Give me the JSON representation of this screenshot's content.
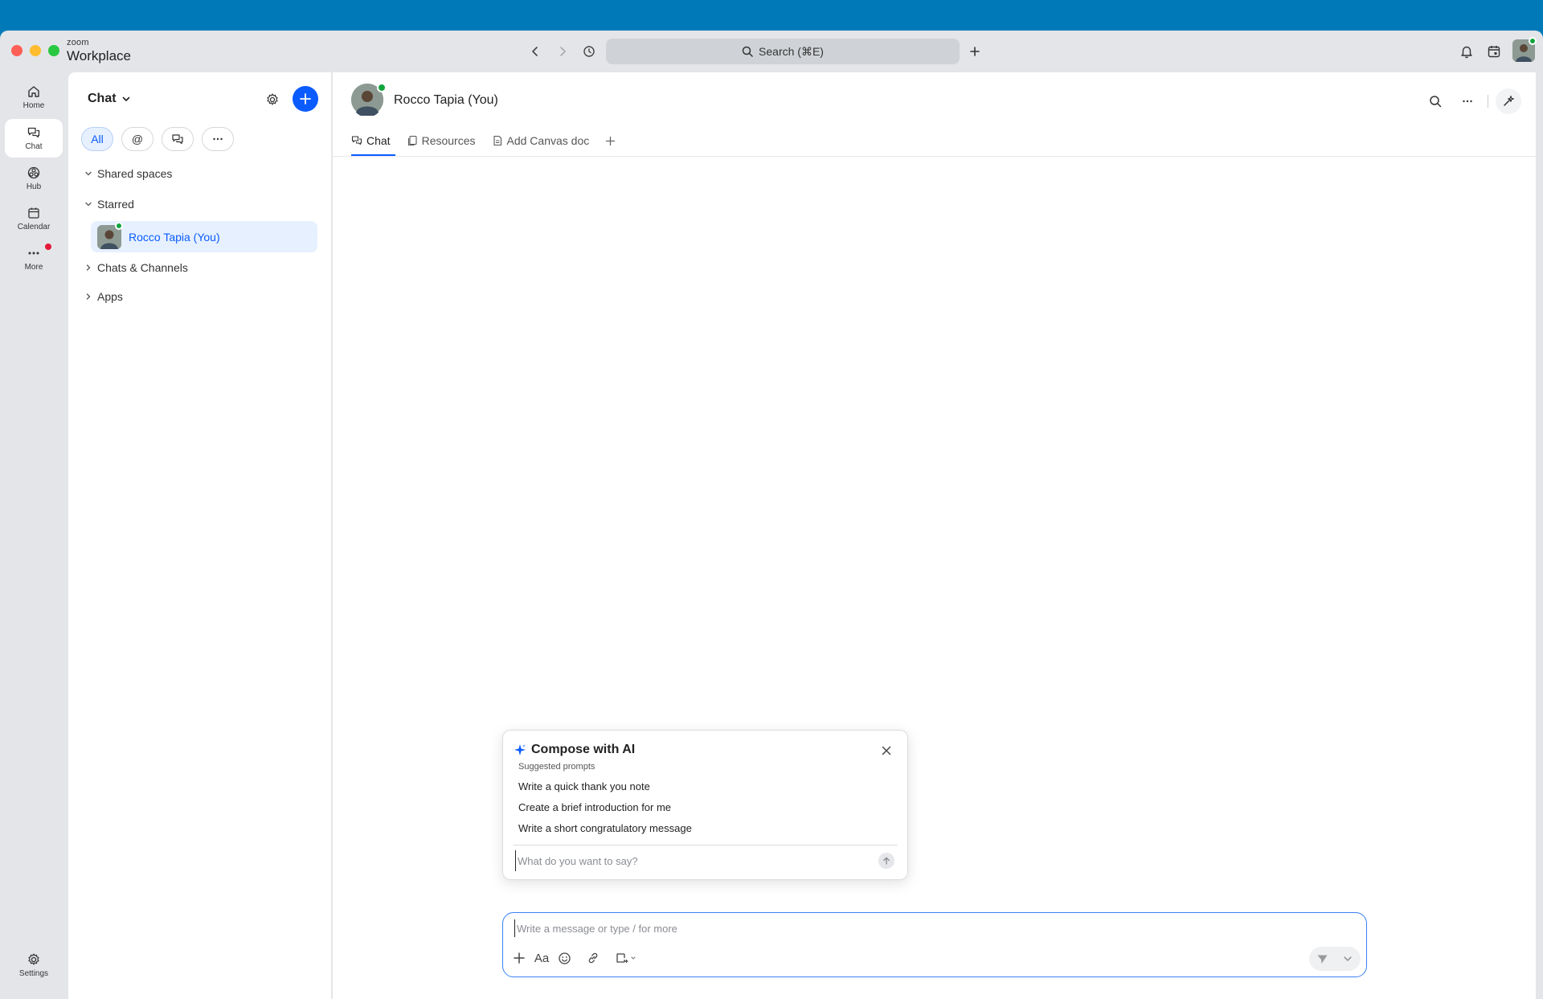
{
  "app": {
    "brand_small": "zoom",
    "brand_big": "Workplace"
  },
  "topbar": {
    "search_label": "Search (⌘E)"
  },
  "rail": {
    "items": [
      {
        "label": "Home",
        "icon": "home-icon"
      },
      {
        "label": "Chat",
        "icon": "chat-icon"
      },
      {
        "label": "Hub",
        "icon": "hub-icon"
      },
      {
        "label": "Calendar",
        "icon": "calendar-icon"
      },
      {
        "label": "More",
        "icon": "more-icon"
      }
    ],
    "settings_label": "Settings"
  },
  "sidebar": {
    "title": "Chat",
    "filters": [
      "All",
      "@"
    ],
    "sections": {
      "shared": "Shared spaces",
      "starred": "Starred",
      "chats": "Chats & Channels",
      "apps": "Apps"
    },
    "starred_contact": "Rocco Tapia (You)"
  },
  "main": {
    "header_name": "Rocco Tapia (You)",
    "tabs": [
      "Chat",
      "Resources",
      "Add Canvas doc"
    ]
  },
  "ai_compose": {
    "title": "Compose with AI",
    "subtitle": "Suggested prompts",
    "prompts": [
      "Write a quick thank you note",
      "Create a brief introduction for me",
      "Write a short congratulatory message"
    ],
    "input_placeholder": "What do you want to say?"
  },
  "composer": {
    "placeholder": "Write a message or type / for more",
    "format_label": "Aa"
  },
  "colors": {
    "accent": "#0b5cff",
    "presence": "#12a53d",
    "titlebar_bg": "#0079b8"
  }
}
